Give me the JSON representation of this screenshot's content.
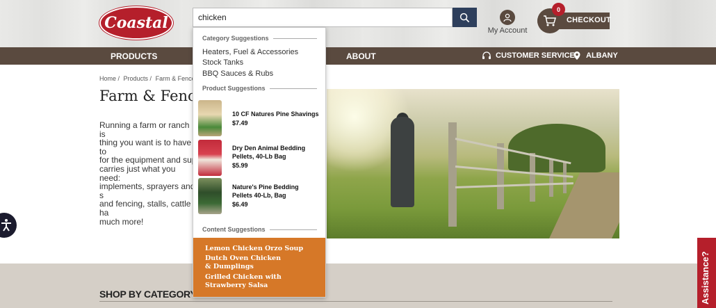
{
  "header": {
    "logo_text": "Coastal",
    "search_value": "chicken",
    "account_label": "My Account",
    "cart_count": "0",
    "checkout_label": "CHECKOUT"
  },
  "nav": {
    "products": "PRODUCTS",
    "about": "ABOUT",
    "customer_service": "CUSTOMER SERVICE",
    "location": "ALBANY"
  },
  "breadcrumb": [
    "Home /",
    "Products /",
    "Farm & Fence"
  ],
  "page": {
    "title": "Farm & Fence",
    "description_lines": "Running a farm or ranch is\nthing you want is to have to\nfor the equipment and sup\ncarries just what you need:\nimplements, sprayers and s\nand fencing, stalls, cattle ha\nmuch more!"
  },
  "dropdown": {
    "category_heading": "Category Suggestions",
    "categories": [
      "Heaters, Fuel & Accessories",
      "Stock Tanks",
      "BBQ Sauces & Rubs"
    ],
    "product_heading": "Product Suggestions",
    "products": [
      {
        "name": "10 CF Natures Pine Shavings",
        "price": "$7.49"
      },
      {
        "name": "Dry Den Animal Bedding Pellets, 40-Lb Bag",
        "price": "$5.99"
      },
      {
        "name": "Nature's Pine Bedding Pellets 40-Lb, Bag",
        "price": "$6.49"
      }
    ],
    "content_heading": "Content Suggestions",
    "content": [
      "Lemon Chicken Orzo Soup",
      "Dutch Oven Chicken & Dumplings",
      "Grilled Chicken with Strawberry Salsa"
    ]
  },
  "sections": {
    "shop_by_category": "SHOP BY CATEGORY",
    "assistance": "Assistance?"
  },
  "colors": {
    "brand_red": "#b51f2b",
    "nav_brown": "#5a4a3f",
    "search_navy": "#2e3f5c",
    "content_orange": "#d67828"
  }
}
